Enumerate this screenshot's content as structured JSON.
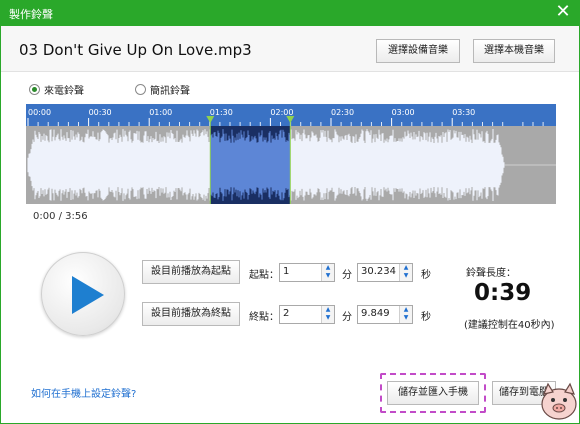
{
  "window": {
    "title": "製作鈴聲",
    "close_glyph": "✕"
  },
  "file": {
    "name": "03 Don't Give Up On Love.mp3"
  },
  "header_buttons": {
    "device_ringtone": "選擇設備音樂",
    "local_ringtone": "選擇本機音樂"
  },
  "modes": [
    {
      "label": "來電鈴聲",
      "selected": true
    },
    {
      "label": "簡訊鈴聲",
      "selected": false
    }
  ],
  "ruler": {
    "ticks": [
      "00:00",
      "00:30",
      "01:00",
      "01:30",
      "02:00",
      "02:30",
      "03:00",
      "03:30"
    ]
  },
  "audio": {
    "duration_s": 236,
    "sel_start_s": 90.234,
    "sel_end_s": 129.849
  },
  "playback": {
    "elapsed": "0:00 / 3:56"
  },
  "start_point": {
    "button": "設目前播放為起點",
    "label": "起點：",
    "minutes": "1",
    "min_unit": "分",
    "seconds": "30.234",
    "sec_unit": "秒"
  },
  "end_point": {
    "button": "設目前播放為終點",
    "label": "終點：",
    "minutes": "2",
    "min_unit": "分",
    "seconds": "9.849",
    "sec_unit": "秒"
  },
  "ring_length": {
    "label": "鈴聲長度：",
    "value": "0:39",
    "note": "(建議控制在40秒內)"
  },
  "footer": {
    "help_link": "如何在手機上設定鈴聲?",
    "save_import": "儲存並匯入手機",
    "save_pc": "儲存到電腦"
  },
  "colors": {
    "titlebar": "#2aa82a",
    "ruler": "#3a72c4",
    "wave_light": "#e8eef9",
    "wave_selected": "#2c4d93",
    "marker": "#8fd14f"
  }
}
